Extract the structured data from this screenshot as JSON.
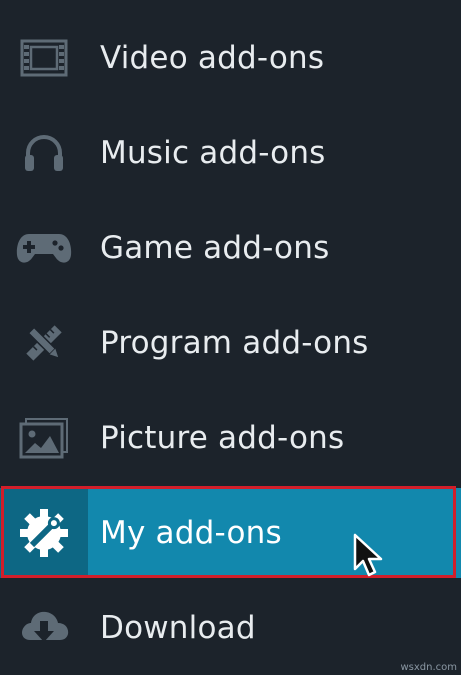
{
  "menu": {
    "items": [
      {
        "label": "Video add-ons",
        "icon": "film-icon"
      },
      {
        "label": "Music add-ons",
        "icon": "headphones-icon"
      },
      {
        "label": "Game add-ons",
        "icon": "gamepad-icon"
      },
      {
        "label": "Program add-ons",
        "icon": "pencil-ruler-icon"
      },
      {
        "label": "Picture add-ons",
        "icon": "picture-icon"
      },
      {
        "label": "My add-ons",
        "icon": "gear-wrench-icon",
        "selected": true
      },
      {
        "label": "Download",
        "icon": "cloud-download-icon"
      }
    ]
  },
  "watermark": "wsxdn.com",
  "colors": {
    "background": "#1c232b",
    "icon": "#5e6b76",
    "selected": "#1288ad",
    "selected_icon_bg": "#0d6784",
    "highlight_border": "#d21e2a"
  }
}
